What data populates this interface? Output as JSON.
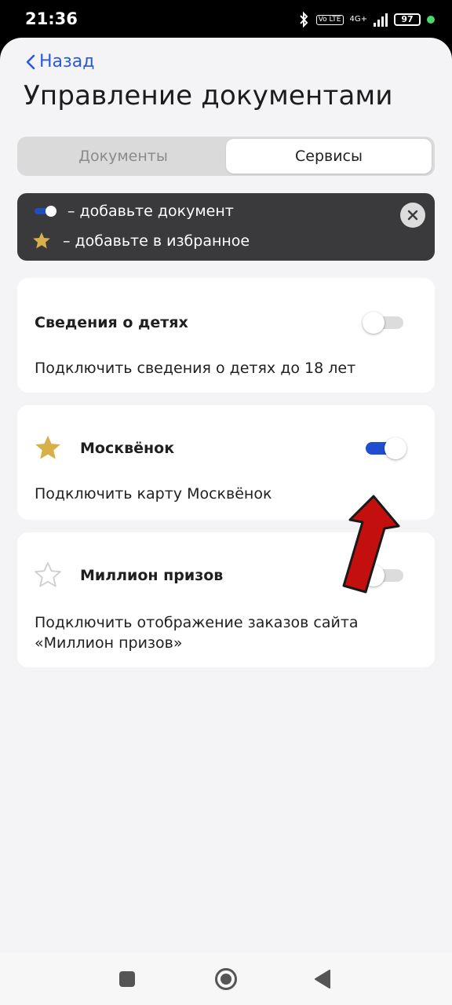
{
  "status_bar": {
    "time": "21:36",
    "volte": "Vo LTE",
    "network": "4G+",
    "battery": "97",
    "icons": [
      "bluetooth-icon",
      "volte-icon",
      "signal-icon",
      "battery-icon",
      "green-dot-icon"
    ]
  },
  "header": {
    "back_label": "Назад",
    "title": "Управление документами"
  },
  "tabs": [
    {
      "label": "Документы",
      "active": false
    },
    {
      "label": "Сервисы",
      "active": true
    }
  ],
  "hint": {
    "toggle_text": "– добавьте документ",
    "star_text": "– добавьте в избранное",
    "close_icon": "close-icon"
  },
  "cards": [
    {
      "title": "Сведения о детях",
      "description": "Подключить сведения о детях до 18 лет",
      "toggle_on": false,
      "star": "none"
    },
    {
      "title": "Москвёнок",
      "description": "Подключить карту Москвёнок",
      "toggle_on": true,
      "star": "filled"
    },
    {
      "title": "Миллион призов",
      "description": "Подключить отображение заказов сайта «Миллион призов»",
      "toggle_on": false,
      "star": "outline"
    }
  ],
  "colors": {
    "accent": "#2a5bd7",
    "toggle_on": "#1f4fd0",
    "star_gold": "#d8b04a",
    "hint_bg": "#3a3a3c",
    "arrow_red": "#c40f0f"
  },
  "navigation_bar": {
    "buttons": [
      "recent-apps-icon",
      "home-icon",
      "back-icon"
    ]
  }
}
